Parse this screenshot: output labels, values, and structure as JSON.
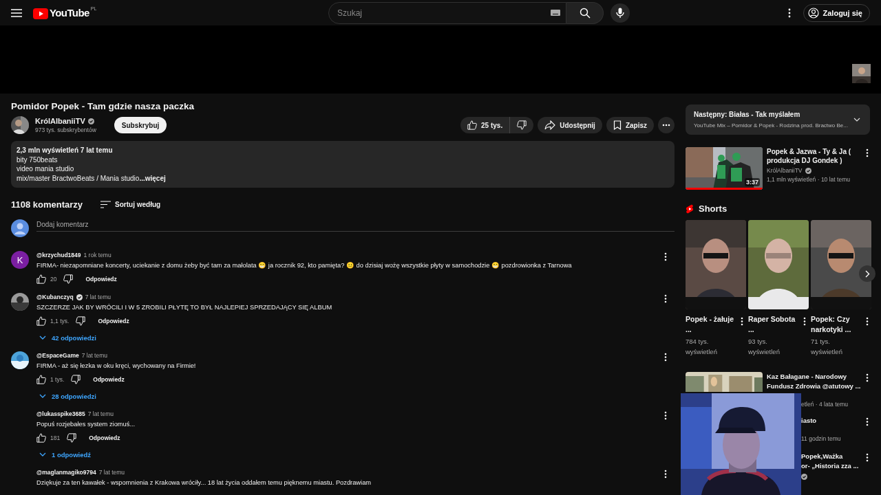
{
  "masthead": {
    "logo": "YouTube",
    "region": "PL",
    "search_placeholder": "Szukaj",
    "sign_in": "Zaloguj się"
  },
  "video": {
    "title": "Pomidor Popek - Tam gdzie nasza paczka",
    "channel": "KrólAlbaniiTV",
    "verified": true,
    "subscribers": "973 tys. subskrybentów",
    "subscribe": "Subskrybuj",
    "likes": "25 tys.",
    "share": "Udostępnij",
    "save": "Zapisz"
  },
  "description": {
    "stats": "2,3 mln wyświetleń  7 lat temu",
    "lines": [
      "bity  750beats",
      "video mania studio",
      "mix/master BractwoBeats / Mania studio"
    ],
    "more": "...więcej"
  },
  "comments": {
    "count": "1108 komentarzy",
    "sort": "Sortuj według",
    "add_placeholder": "Dodaj komentarz",
    "items": [
      {
        "author": "@krzychud1849",
        "verified": false,
        "time": "1 rok temu",
        "avatar": {
          "kind": "letter",
          "letter": "K",
          "color": "#7b1fa2"
        },
        "text": "FIRMA- niezapomniane koncerty, uciekanie z domu żeby być tam za małolata 😁  ja rocznik 92, kto pamięta? 😐  do dzisiaj wożę wszystkie płyty w samochodzie 😁  pozdrowionka z Tarnowa",
        "likes": "20",
        "reply": "Odpowiedz"
      },
      {
        "author": "@Kubanczyq",
        "verified": true,
        "time": "7 lat temu",
        "text": "SZCZERZE JAK BY WRÓCILI I W 5 ZROBILI PŁYTĘ TO BYŁ NAJLEPIEJ SPRZEDAJĄCY SIĘ ALBUM",
        "likes": "1,1 tys.",
        "reply": "Odpowiedz",
        "replies": "42 odpowiedzi"
      },
      {
        "author": "@EspaceGame",
        "verified": false,
        "time": "7 lat temu",
        "text": "FIRMA - aż się łezka w oku kręci, wychowany na Firmie!",
        "likes": "1 tys.",
        "reply": "Odpowiedz",
        "replies": "28 odpowiedzi"
      },
      {
        "author": "@lukasspike3685",
        "verified": false,
        "time": "7 lat temu",
        "avatar": {
          "kind": "none"
        },
        "text": "Popuś rozjebałes system ziomuś...",
        "likes": "181",
        "reply": "Odpowiedz",
        "replies": "1 odpowiedź"
      },
      {
        "author": "@maglanmagiko9794",
        "verified": false,
        "time": "7 lat temu",
        "avatar": {
          "kind": "none"
        },
        "text": "Dziękuje za ten kawałek - wspomnienia z Krakowa wróciły... 18 lat życia oddałem temu pięknemu miastu. Pozdrawiam"
      }
    ]
  },
  "sidebar": {
    "next": {
      "label": "Następny: Białas - Tak myślałem",
      "subtitle": "YouTube Mix – Pomidor & Popek - Rodzina prod. Bractwo Be..."
    },
    "videos": [
      {
        "title": "Popek & Jazwa - Ty & Ja ( produkcja DJ Gondek )",
        "channel": "KrólAlbaniiTV",
        "verified": true,
        "meta": "1,1 mln wyświetleń · 10 lat temu",
        "duration": "3:37",
        "watched": true
      }
    ],
    "shorts": {
      "title": "Shorts",
      "items": [
        {
          "title": "Popek - żałuje ...",
          "views": "784 tys. wyświetleń"
        },
        {
          "title": "Raper Sobota ...",
          "views": "93 tys. wyświetleń"
        },
        {
          "title": "Popek: Czy narkotyki ...",
          "views": "71 tys. wyświetleń"
        }
      ]
    },
    "more_videos": [
      {
        "thumbnail": true,
        "lines": [
          {
            "kind": "title",
            "text": "Kaz Bałagane - Narodowy Fundusz Zdrowia @atutowy ...",
            "cut": false
          },
          {
            "kind": "meta",
            "text": "etleń · 4 lata temu",
            "cut": true
          }
        ]
      },
      {
        "thumbnail": false,
        "lines": [
          {
            "kind": "title",
            "text": "iasto",
            "cut": true
          },
          {
            "kind": "meta",
            "text": "11 godzin temu",
            "cut": true
          }
        ]
      },
      {
        "thumbnail": false,
        "verified": true,
        "lines": [
          {
            "kind": "title",
            "text": "Popek,Ważka",
            "cut": true
          },
          {
            "kind": "title",
            "text": "or-  „Historia zza ...",
            "cut": true
          }
        ]
      }
    ]
  }
}
